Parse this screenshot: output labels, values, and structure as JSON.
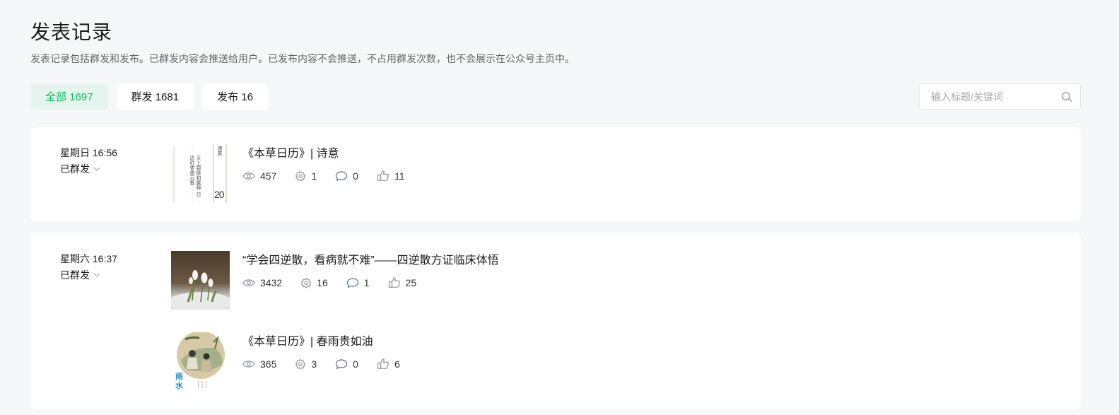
{
  "page": {
    "title": "发表记录",
    "description": "发表记录包括群发和发布。已群发内容会推送给用户。已发布内容不会推送，不占用群发次数，也不会展示在公众号主页中。"
  },
  "tabs": [
    {
      "label": "全部 1697",
      "active": true
    },
    {
      "label": "群发 1681",
      "active": false
    },
    {
      "label": "发布 16",
      "active": false
    }
  ],
  "search": {
    "placeholder": "输入标题/关键词",
    "value": "",
    "icon": "search-icon"
  },
  "records": [
    {
      "time": "星期日 16:56",
      "status": "已群发",
      "articles": [
        {
          "title": "《本草日历》| 诗意",
          "thumb_text": {
            "header": "诗意",
            "number": "20",
            "left_column": "天上碧桃和露种 日边红杏倚云栽"
          },
          "views": "457",
          "shares": "1",
          "comments": "0",
          "likes": "11"
        }
      ]
    },
    {
      "time": "星期六 16:37",
      "status": "已群发",
      "articles": [
        {
          "title": "“学会四逆散，看病就不难”——四逆散方证临床体悟",
          "views": "3432",
          "shares": "16",
          "comments": "1",
          "likes": "25"
        },
        {
          "title": "《本草日历》| 春雨贵如油",
          "thumb_text": {
            "label": "雨水"
          },
          "views": "365",
          "shares": "3",
          "comments": "0",
          "likes": "6"
        }
      ]
    }
  ],
  "colors": {
    "accent": "#07c160",
    "active_tab_bg": "#e5f4ec",
    "background": "#f6f7f9",
    "icon": "#8a8f99"
  }
}
